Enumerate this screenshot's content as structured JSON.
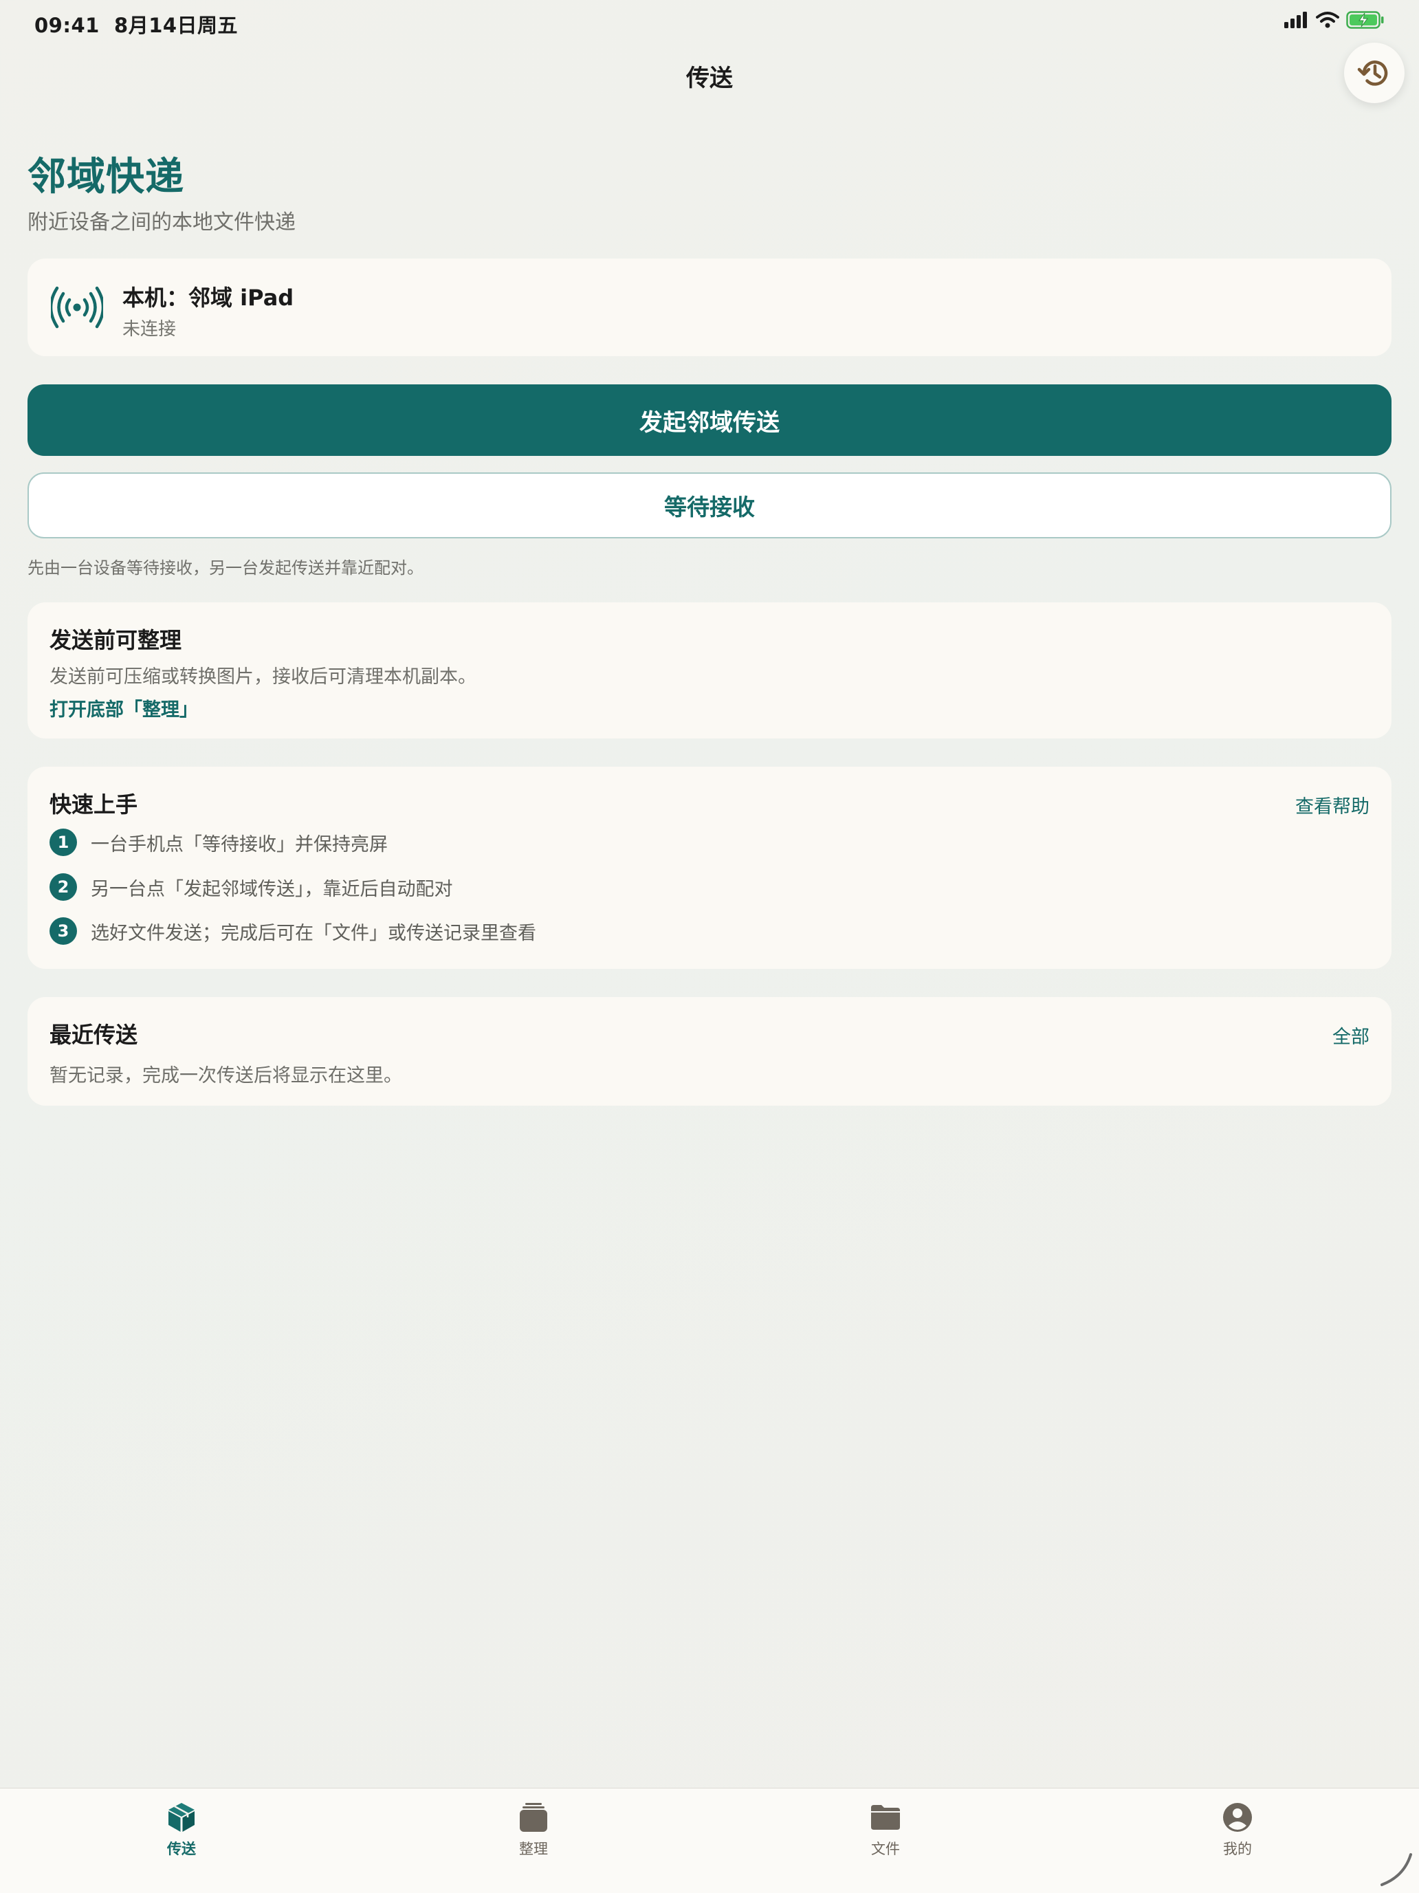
{
  "status_bar": {
    "time": "09:41",
    "date": "8月14日周五",
    "icons": [
      "signal-icon",
      "wifi-icon",
      "battery-charging-icon"
    ]
  },
  "nav": {
    "title": "传送",
    "history_icon": "history-icon"
  },
  "hero": {
    "title": "邻域快递",
    "subtitle": "附近设备之间的本地文件快递"
  },
  "device": {
    "icon": "broadcast-icon",
    "name": "本机：邻域 iPad",
    "status": "未连接"
  },
  "actions": {
    "primary": "发起邻域传送",
    "secondary": "等待接收",
    "hint": "先由一台设备等待接收，另一台发起传送并靠近配对。"
  },
  "organize": {
    "title": "发送前可整理",
    "text": "发送前可压缩或转换图片，接收后可清理本机副本。",
    "link": "打开底部「整理」"
  },
  "quick_start": {
    "title": "快速上手",
    "help_link": "查看帮助",
    "steps": [
      {
        "num": "1",
        "text": "一台手机点「等待接收」并保持亮屏"
      },
      {
        "num": "2",
        "text": "另一台点「发起邻域传送」，靠近后自动配对"
      },
      {
        "num": "3",
        "text": "选好文件发送；完成后可在「文件」或传送记录里查看"
      }
    ]
  },
  "recent": {
    "title": "最近传送",
    "all_link": "全部",
    "empty_text": "暂无记录，完成一次传送后将显示在这里。"
  },
  "tabs": [
    {
      "label": "传送",
      "icon": "package-icon",
      "active": true
    },
    {
      "label": "整理",
      "icon": "tray-stack-icon",
      "active": false
    },
    {
      "label": "文件",
      "icon": "folder-icon",
      "active": false
    },
    {
      "label": "我的",
      "icon": "person-icon",
      "active": false
    }
  ],
  "colors": {
    "accent": "#146a68",
    "background": "#f0f1ec",
    "card": "#fbf9f4",
    "muted_text": "#70706b",
    "tab_inactive": "#6c655c",
    "history_icon": "#7a5a36"
  }
}
